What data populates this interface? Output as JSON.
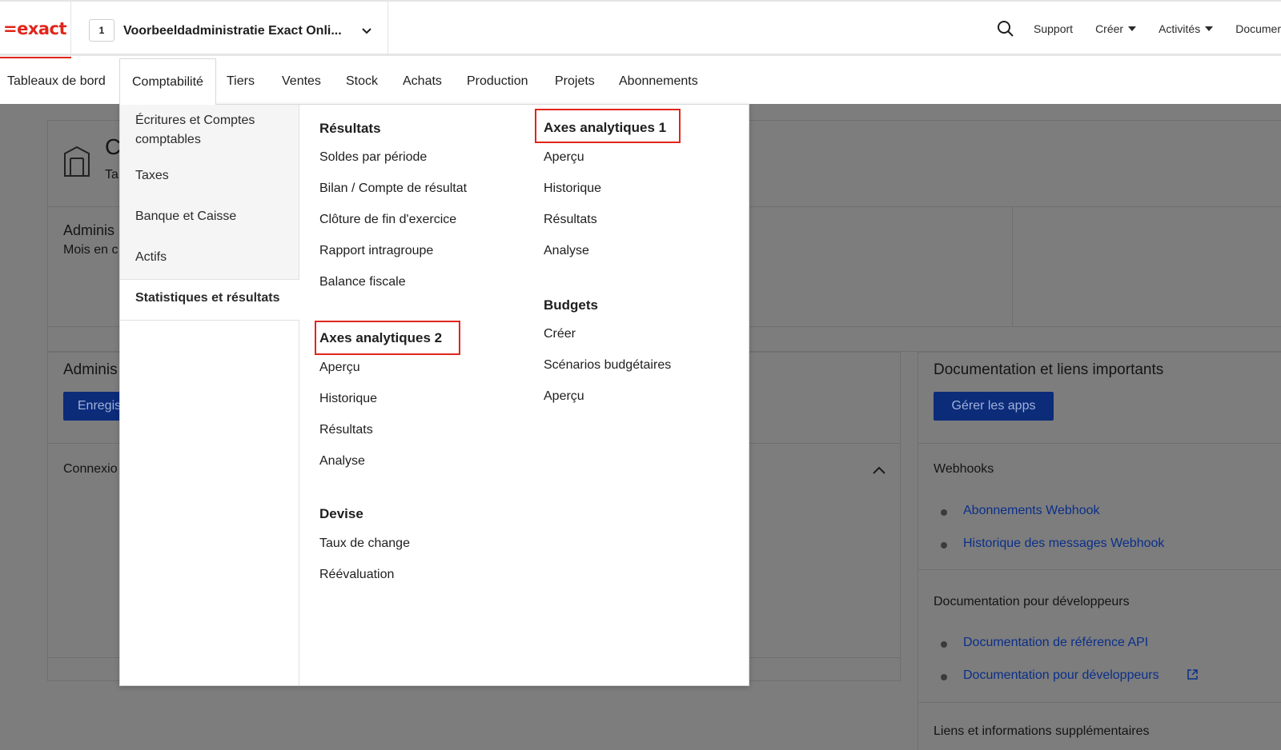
{
  "header": {
    "logo_text": "=exact",
    "division_number": "1",
    "division_name": "Voorbeeldadministratie Exact Onli...",
    "links": [
      {
        "label": "Support"
      },
      {
        "label": "Créer"
      },
      {
        "label": "Activités"
      },
      {
        "label": "Documer"
      }
    ]
  },
  "nav": {
    "items": [
      {
        "label": "Tableaux de bord"
      },
      {
        "label": "Comptabilité"
      },
      {
        "label": "Tiers"
      },
      {
        "label": "Ventes"
      },
      {
        "label": "Stock"
      },
      {
        "label": "Achats"
      },
      {
        "label": "Production"
      },
      {
        "label": "Projets"
      },
      {
        "label": "Abonnements"
      }
    ],
    "active": "Comptabilité"
  },
  "dropdown": {
    "side": {
      "items": [
        {
          "label": "Écritures et Comptes comptables"
        },
        {
          "label": "Taxes"
        },
        {
          "label": "Banque et Caisse"
        },
        {
          "label": "Actifs"
        },
        {
          "label": "Statistiques et résultats"
        }
      ]
    },
    "resultats": {
      "title": "Résultats",
      "items": [
        "Soldes par période",
        "Bilan / Compte de résultat",
        "Clôture de fin d'exercice",
        "Rapport intragroupe",
        "Balance fiscale"
      ]
    },
    "axes2": {
      "title": "Axes analytiques 2",
      "items": [
        "Aperçu",
        "Historique",
        "Résultats",
        "Analyse"
      ]
    },
    "devise": {
      "title": "Devise",
      "items": [
        "Taux de change",
        "Réévaluation"
      ]
    },
    "axes1": {
      "title": "Axes analytiques 1",
      "items": [
        "Aperçu",
        "Historique",
        "Résultats",
        "Analyse"
      ]
    },
    "budgets": {
      "title": "Budgets",
      "items": [
        "Créer",
        "Scénarios budgétaires",
        "Aperçu"
      ]
    }
  },
  "background": {
    "partial_c": "C",
    "partial_ta": "Ta",
    "admin_title": "Adminis",
    "admin_sub": "Mois en c",
    "admin2_title": "Adminis",
    "admin2_btn": "Enregis",
    "connexion": "Connexio",
    "doc_title": "Documentation et liens importants",
    "doc_btn": "Gérer les apps",
    "webhooks_title": "Webhooks",
    "webhook_links": [
      "Abonnements Webhook",
      "Historique des messages Webhook"
    ],
    "devdoc_title": "Documentation pour développeurs",
    "devdoc_links": [
      "Documentation de référence API",
      "Documentation pour développeurs"
    ],
    "more_title": "Liens et informations supplémentaires"
  }
}
